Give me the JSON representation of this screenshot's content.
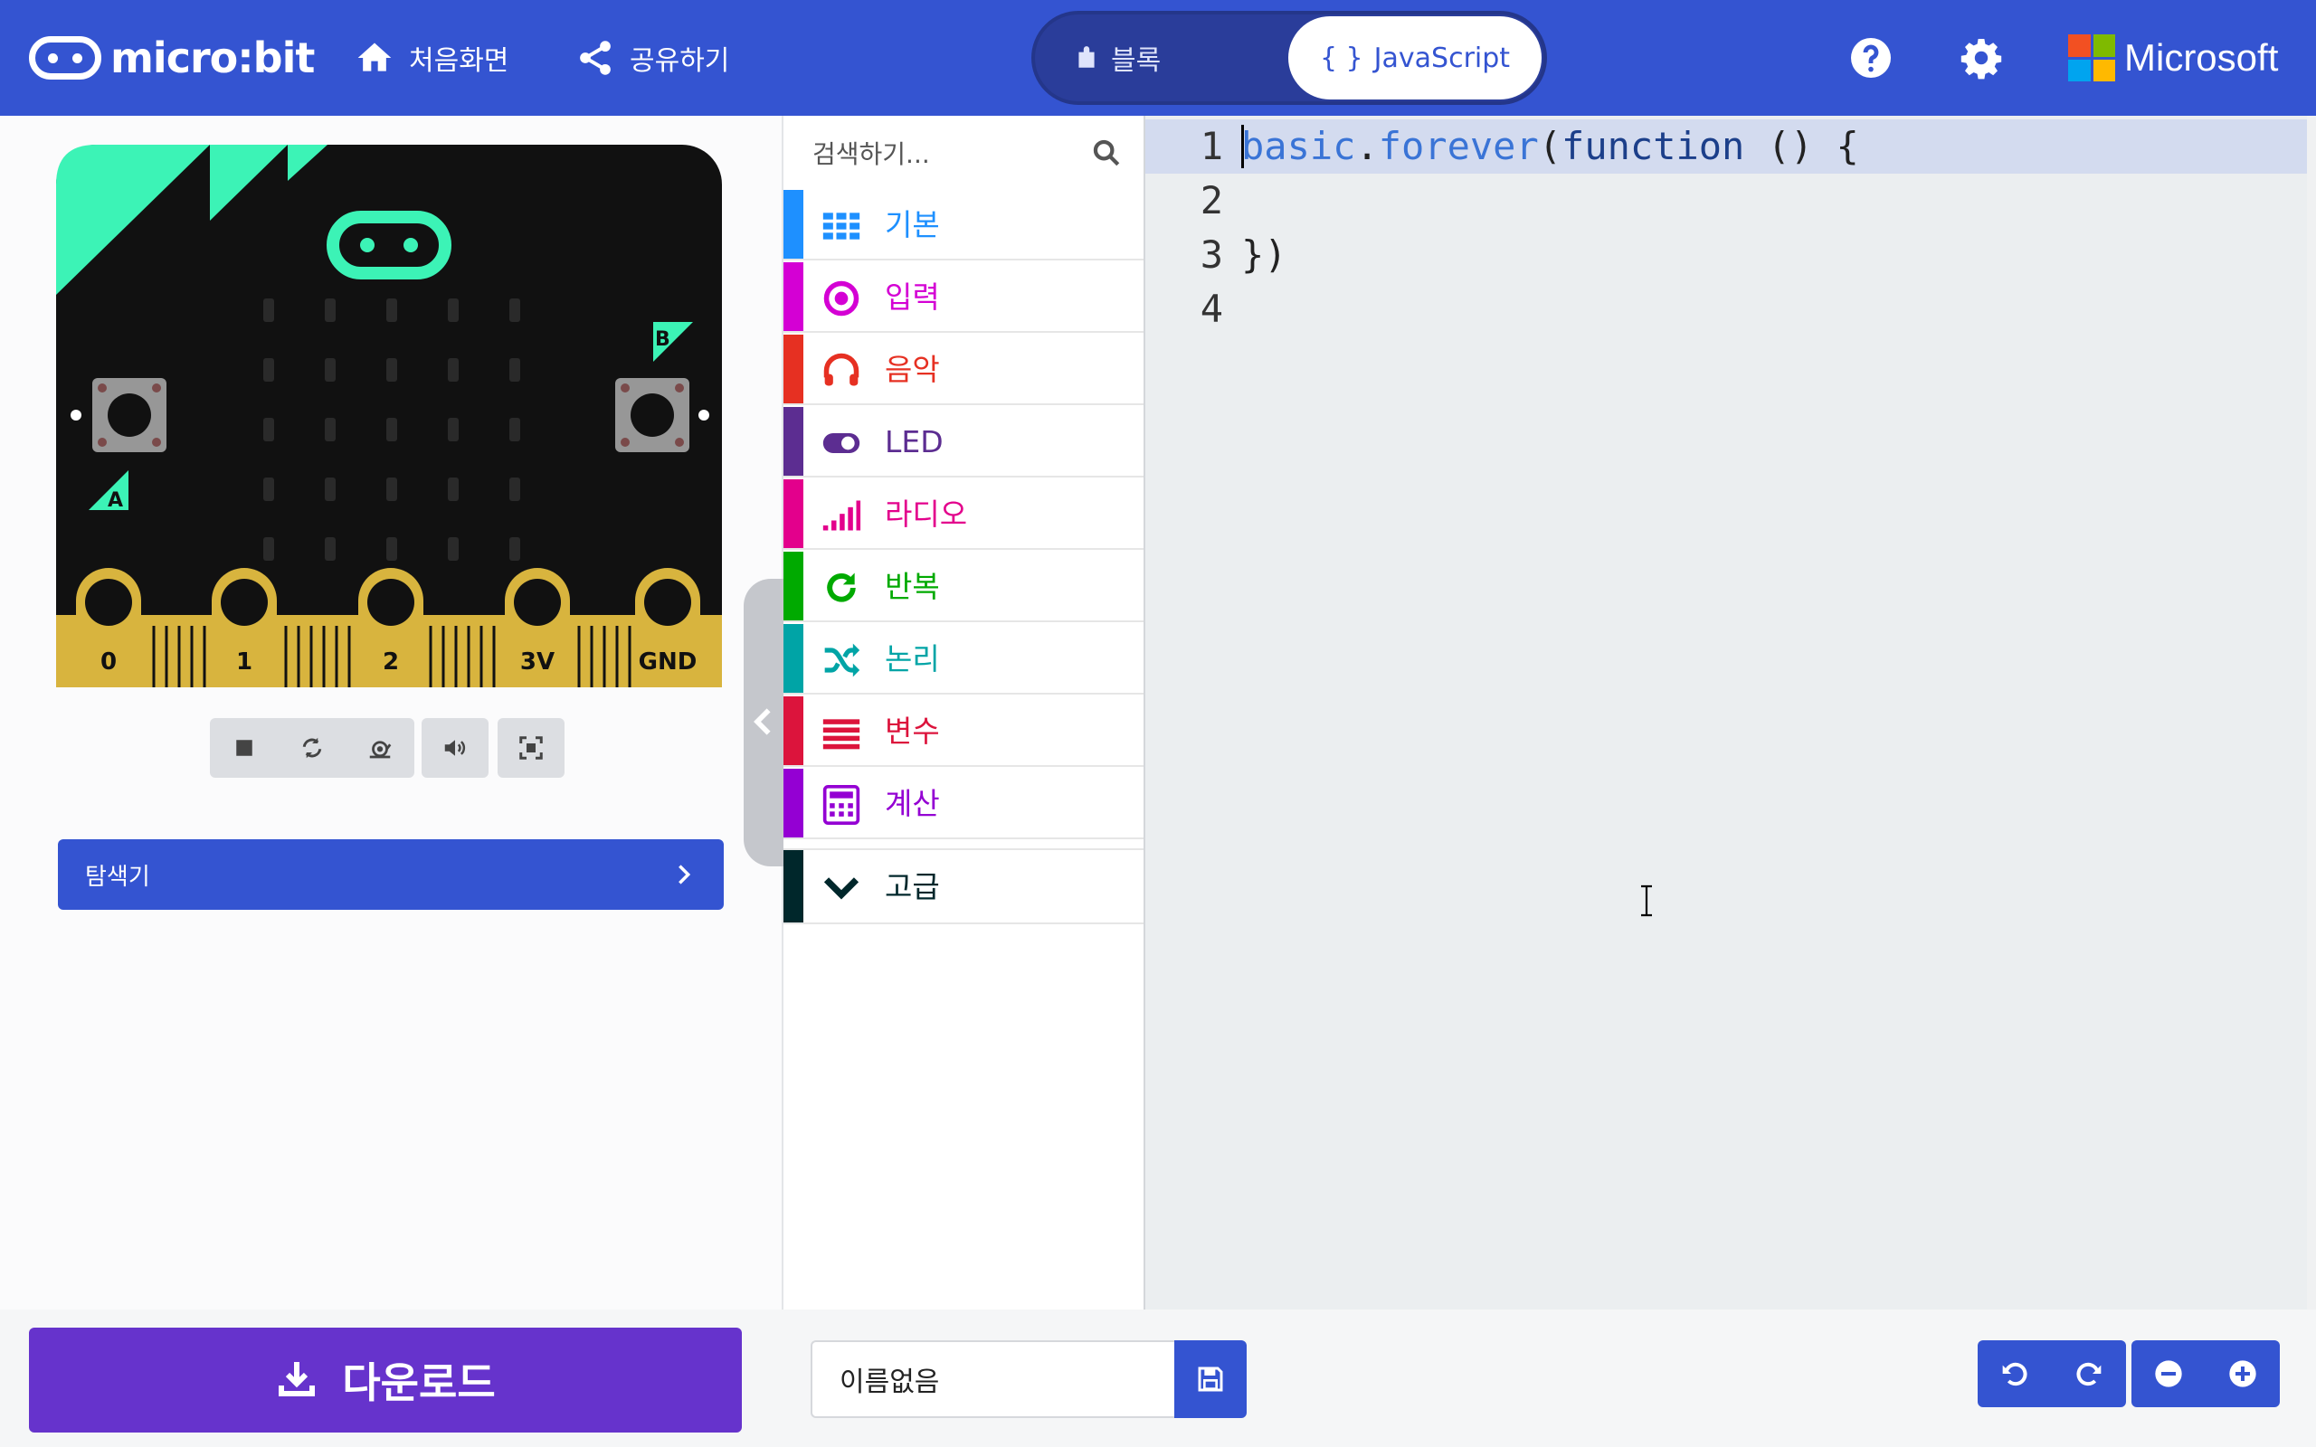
{
  "header": {
    "logo_text": "micro:bit",
    "home_label": "처음화면",
    "share_label": "공유하기",
    "toggle": {
      "blocks_label": "블록",
      "js_label": "JavaScript",
      "active": "JavaScript"
    },
    "microsoft_label": "Microsoft",
    "brand_color": "#3454d1"
  },
  "simulator": {
    "button_labels": {
      "a": "A",
      "b": "B"
    },
    "pins": [
      "0",
      "1",
      "2",
      "3V",
      "GND"
    ],
    "controls": [
      "stop-icon",
      "restart-icon",
      "slow-mo-icon",
      "mute-icon",
      "fullscreen-icon"
    ],
    "explorer_label": "탐색기"
  },
  "toolbox": {
    "search_placeholder": "검색하기...",
    "categories": [
      {
        "label": "기본",
        "color": "#1e90ff",
        "icon": "grid-icon"
      },
      {
        "label": "입력",
        "color": "#d400d4",
        "icon": "target-icon"
      },
      {
        "label": "음악",
        "color": "#e63022",
        "icon": "headphones-icon"
      },
      {
        "label": "LED",
        "color": "#5c2d91",
        "icon": "toggle-icon"
      },
      {
        "label": "라디오",
        "color": "#e3008c",
        "icon": "signal-icon"
      },
      {
        "label": "반복",
        "color": "#00aa00",
        "icon": "loop-icon"
      },
      {
        "label": "논리",
        "color": "#00a4a6",
        "icon": "shuffle-icon"
      },
      {
        "label": "변수",
        "color": "#dc143c",
        "icon": "lines-icon"
      },
      {
        "label": "계산",
        "color": "#9400d3",
        "icon": "calculator-icon"
      }
    ],
    "advanced": {
      "label": "고급",
      "color": "#00272b",
      "icon": "chevron-down-icon"
    }
  },
  "editor": {
    "lines": [
      {
        "num": "1",
        "obj": "basic",
        "dot": ".",
        "method": "forever",
        "paren": "(",
        "kw": "function",
        "rest": " () {"
      },
      {
        "num": "2",
        "text": ""
      },
      {
        "num": "3",
        "text": "})"
      },
      {
        "num": "4",
        "text": ""
      }
    ]
  },
  "footer": {
    "download_label": "다운로드",
    "project_name": "이름없음",
    "download_color": "#6633cc"
  }
}
